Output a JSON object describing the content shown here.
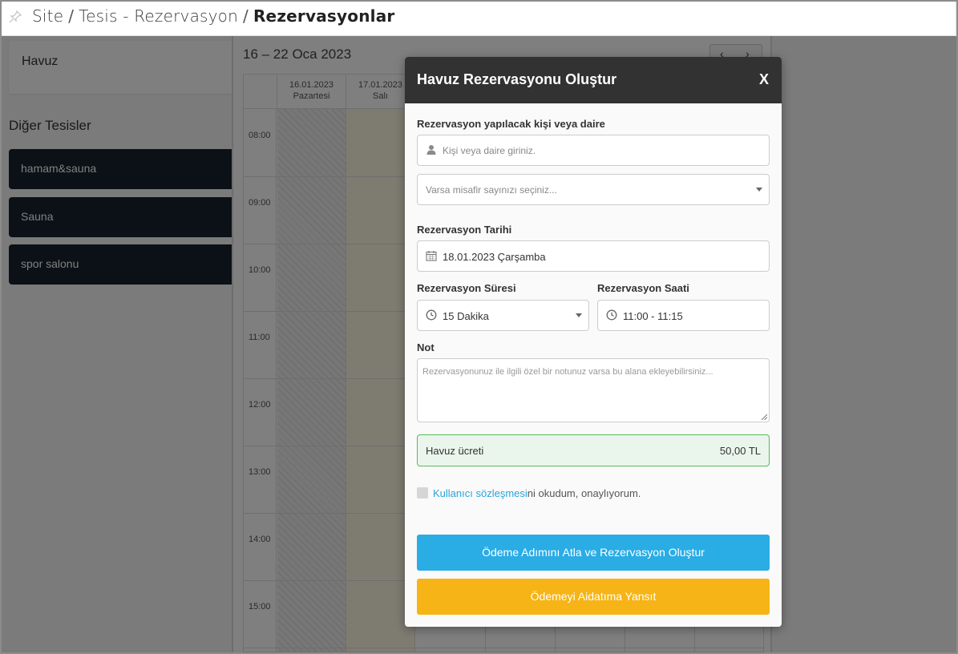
{
  "breadcrumb": {
    "items": [
      "Site",
      "Tesis - Rezervasyon"
    ],
    "separator": "/",
    "current": "Rezervasyonlar"
  },
  "sidebar": {
    "facility": "Havuz",
    "other_title": "Diğer Tesisler",
    "items": [
      {
        "label": "hamam&sauna"
      },
      {
        "label": "Sauna"
      },
      {
        "label": "spor salonu"
      }
    ]
  },
  "calendar": {
    "range": "16 – 22 Oca 2023",
    "prev": "‹",
    "next": "›",
    "days": [
      {
        "date": "16.01.2023",
        "name": "Pazartesi"
      },
      {
        "date": "17.01.2023",
        "name": "Salı"
      }
    ],
    "times": [
      "08:00",
      "09:00",
      "10:00",
      "11:00",
      "12:00",
      "13:00",
      "14:00",
      "15:00"
    ]
  },
  "modal": {
    "title": "Havuz Rezervasyonu Oluştur",
    "close": "X",
    "person_label": "Rezervasyon yapılacak kişi veya daire",
    "person_placeholder": "Kişi veya daire giriniz.",
    "guest_placeholder": "Varsa misafir sayınızı seçiniz...",
    "date_label": "Rezervasyon Tarihi",
    "date_value": "18.01.2023 Çarşamba",
    "duration_label": "Rezervasyon Süresi",
    "duration_value": "15 Dakika",
    "time_label": "Rezervasyon Saati",
    "time_value": "11:00 - 11:15",
    "note_label": "Not",
    "note_placeholder": "Rezervasyonunuz ile ilgili özel bir notunuz varsa bu alana ekleyebilirsiniz...",
    "fee_label": "Havuz ücreti",
    "fee_amount": "50,00 TL",
    "agreement_link": "Kullanıcı sözleşmesi",
    "agreement_text": "ni okudum, onaylıyorum.",
    "btn_skip_payment": "Ödeme Adımını Atla ve Rezervasyon Oluştur",
    "btn_dues": "Ödemeyi Aidatıma Yansıt"
  },
  "colors": {
    "sidebar_item_bg": "#17232c",
    "modal_header_bg": "#323232",
    "primary_blue": "#2aace5",
    "warning_yellow": "#f6b416",
    "fee_bg": "#eaf6ec",
    "fee_border": "#5cb85c",
    "today_bg": "#fcf8e3"
  }
}
